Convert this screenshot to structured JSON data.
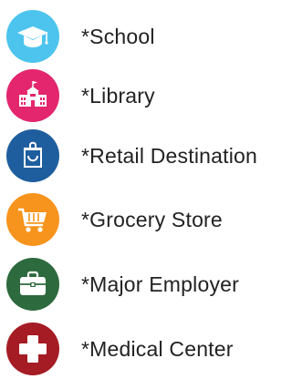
{
  "legend": {
    "items": [
      {
        "label": "*School",
        "icon": "graduation-cap-icon",
        "color": "#4CC4EE"
      },
      {
        "label": "*Library",
        "icon": "library-building-icon",
        "color": "#E3266E"
      },
      {
        "label": "*Retail Destination",
        "icon": "shopping-bag-icon",
        "color": "#1F5E9E"
      },
      {
        "label": "*Grocery Store",
        "icon": "shopping-cart-icon",
        "color": "#F7941D"
      },
      {
        "label": "*Major Employer",
        "icon": "briefcase-icon",
        "color": "#2D6A3E"
      },
      {
        "label": "*Medical Center",
        "icon": "medical-cross-icon",
        "color": "#A51C24"
      }
    ]
  }
}
